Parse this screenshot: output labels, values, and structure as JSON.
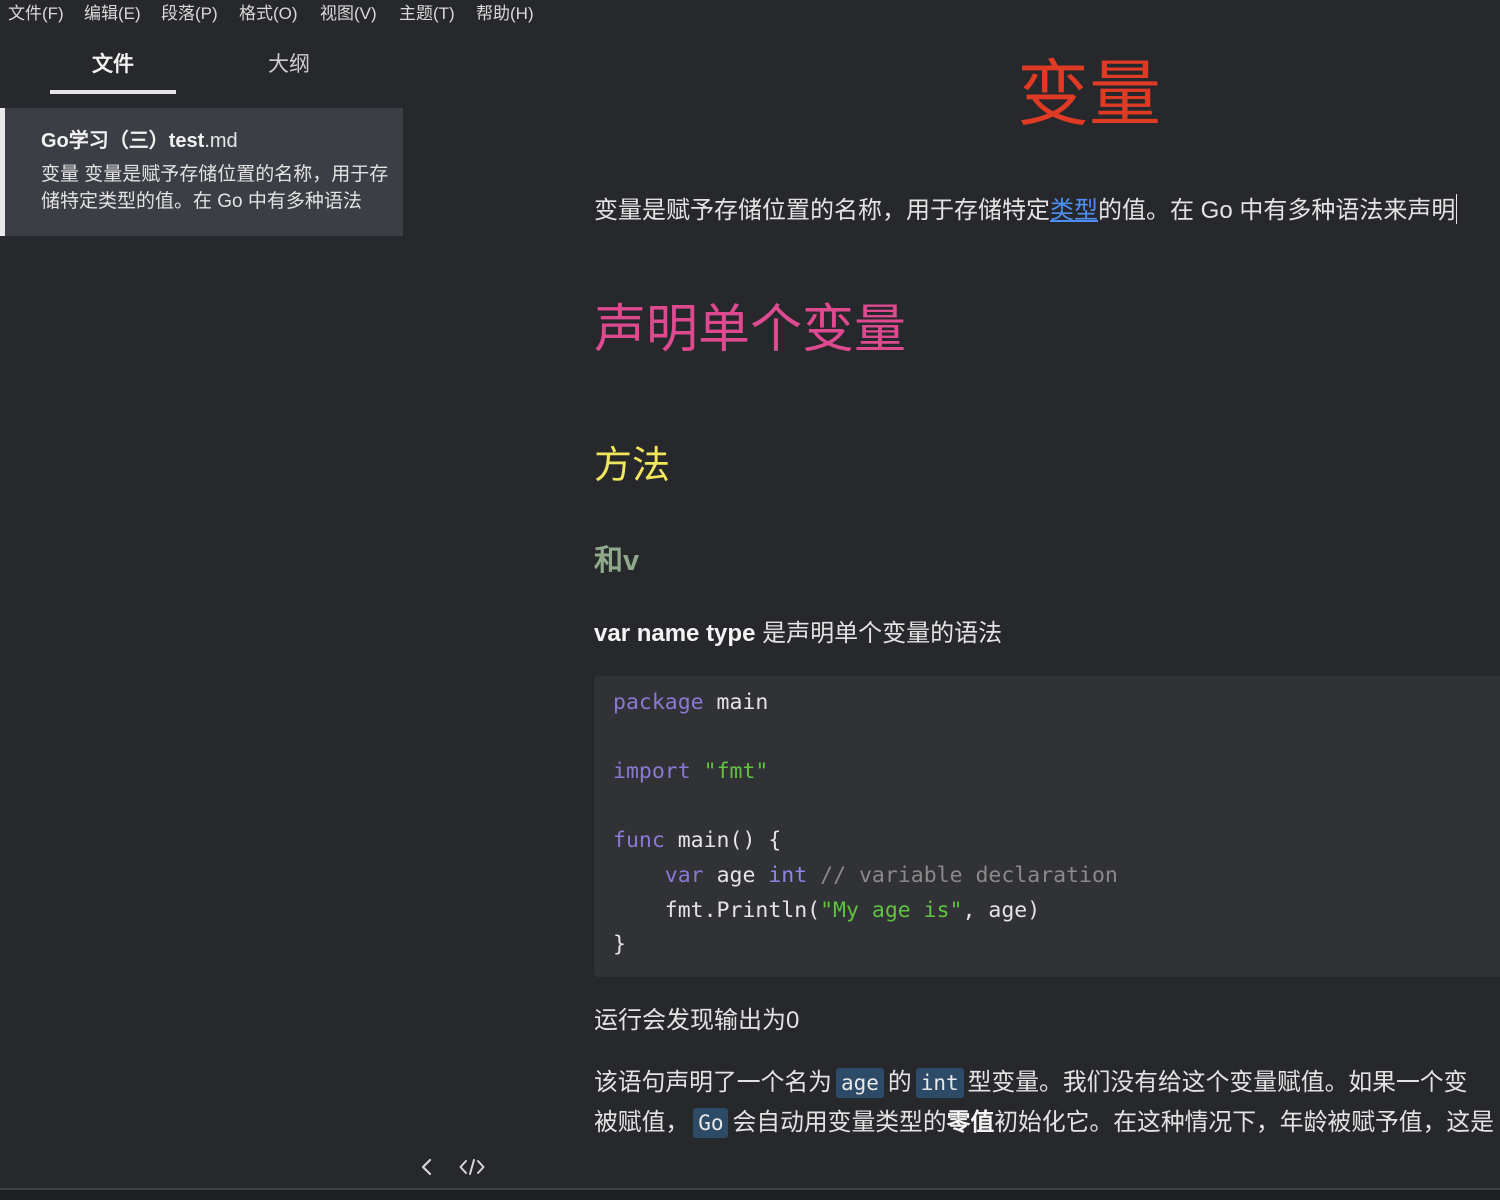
{
  "app": {
    "menu": [
      "文件(F)",
      "编辑(E)",
      "段落(P)",
      "格式(O)",
      "视图(V)",
      "主题(T)",
      "帮助(H)"
    ]
  },
  "sidebar": {
    "tabs": [
      {
        "label": "文件",
        "active": true
      },
      {
        "label": "大纲",
        "active": false
      }
    ],
    "files": [
      {
        "name": "Go学习（三）test",
        "ext": ".md",
        "preview": "变量 变量是赋予存储位置的名称，用于存储特定类型的值。在 Go 中有多种语法",
        "selected": true
      }
    ]
  },
  "footer": {
    "icons": [
      "chevron-left-icon",
      "code-icon"
    ]
  },
  "document": {
    "h1": "变量",
    "p1": {
      "before_link": "变量是赋予存储位置的名称，用于存储特定",
      "link": "类型",
      "after_link": "的值。在 Go 中有多种语法来声明"
    },
    "h2": "声明单个变量",
    "h3": "方法",
    "h4": "和v",
    "p2": {
      "bold": "var name type",
      "rest": " 是声明单个变量的语法"
    },
    "code": {
      "language": "go",
      "lines": [
        [
          {
            "type": "keyword",
            "text": "package"
          },
          {
            "type": "text",
            "text": " main"
          }
        ],
        [],
        [
          {
            "type": "keyword",
            "text": "import"
          },
          {
            "type": "text",
            "text": " "
          },
          {
            "type": "string",
            "text": "\"fmt\""
          }
        ],
        [],
        [
          {
            "type": "keyword",
            "text": "func"
          },
          {
            "type": "text",
            "text": " main() {"
          }
        ],
        [
          {
            "type": "text",
            "text": "    "
          },
          {
            "type": "keyword",
            "text": "var"
          },
          {
            "type": "text",
            "text": " age "
          },
          {
            "type": "type",
            "text": "int"
          },
          {
            "type": "text",
            "text": " "
          },
          {
            "type": "comment",
            "text": "// variable declaration"
          }
        ],
        [
          {
            "type": "text",
            "text": "    fmt.Println("
          },
          {
            "type": "string",
            "text": "\"My age is\""
          },
          {
            "type": "text",
            "text": ", age)"
          }
        ],
        [
          {
            "type": "text",
            "text": "}"
          }
        ]
      ]
    },
    "p3": "运行会发现输出为0",
    "p4": {
      "t1": "该语句声明了一个名为",
      "c1": "age",
      "t2": "的",
      "c2": "int",
      "t3": "型变量。我们没有给这个变量赋值。如果一个变",
      "t4": "被赋值，",
      "c3": "Go",
      "t5": "会自动用变量类型的",
      "b1": "零值",
      "t6": "初始化它。在这种情况下，年龄被赋予值，这是"
    }
  },
  "colors": {
    "heading1": "#df3a24",
    "heading2": "#dd4a8f",
    "heading3": "#f2e65c",
    "heading4": "#91a98b",
    "link": "#4d8ff5",
    "code_keyword": "#8b78d2",
    "code_type": "#8d84e6",
    "code_string": "#60c23f",
    "code_comment": "#8a8a8a",
    "inline_code_bg": "#2d4a66"
  }
}
